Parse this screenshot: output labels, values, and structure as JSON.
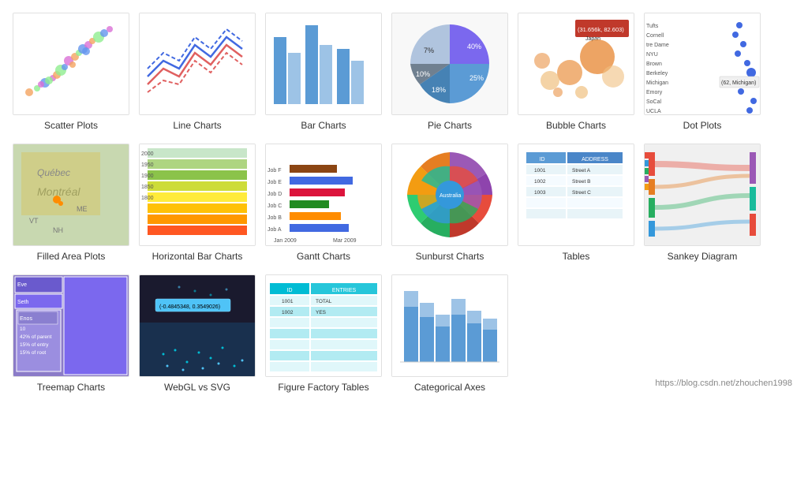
{
  "charts": {
    "row1": [
      {
        "id": "scatter-plots",
        "label": "Scatter Plots"
      },
      {
        "id": "line-charts",
        "label": "Line Charts"
      },
      {
        "id": "bar-charts",
        "label": "Bar Charts"
      },
      {
        "id": "pie-charts",
        "label": "Pie Charts"
      },
      {
        "id": "bubble-charts",
        "label": "Bubble Charts"
      },
      {
        "id": "dot-plots",
        "label": "Dot Plots"
      }
    ],
    "row2": [
      {
        "id": "filled-area-plots",
        "label": "Filled Area Plots"
      },
      {
        "id": "horizontal-bar-charts",
        "label": "Horizontal Bar Charts"
      },
      {
        "id": "gantt-charts",
        "label": "Gantt Charts"
      },
      {
        "id": "sunburst-charts",
        "label": "Sunburst Charts"
      },
      {
        "id": "tables",
        "label": "Tables"
      },
      {
        "id": "sankey-diagram",
        "label": "Sankey Diagram"
      }
    ],
    "row3": [
      {
        "id": "treemap-charts",
        "label": "Treemap Charts"
      },
      {
        "id": "webgl-vs-svg",
        "label": "WebGL vs SVG"
      },
      {
        "id": "figure-factory-tables",
        "label": "Figure Factory Tables"
      },
      {
        "id": "categorical-axes",
        "label": "Categorical Axes"
      }
    ]
  },
  "footer": {
    "link": "https://blog.csdn.net/zhouchen1998"
  }
}
